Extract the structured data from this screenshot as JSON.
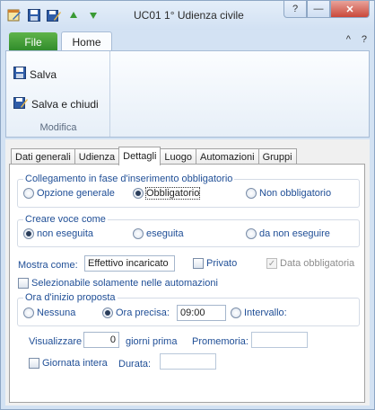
{
  "window": {
    "title": "UC01 1° Udienza civile",
    "help_glyph": "?",
    "minimize_glyph": "—",
    "close_glyph": "✕"
  },
  "ribbon": {
    "file_tab": "File",
    "home_tab": "Home",
    "collapse_glyph": "^",
    "help_glyph": "?",
    "group_label": "Modifica",
    "save_label": "Salva",
    "save_close_label": "Salva e chiudi"
  },
  "tabs": [
    "Dati generali",
    "Udienza",
    "Dettagli",
    "Luogo",
    "Automazioni",
    "Gruppi"
  ],
  "active_tab": "Dettagli",
  "collegamento": {
    "legend": "Collegamento in fase d'inserimento obbligatorio",
    "options": [
      "Opzione generale",
      "Obbligatorio",
      "Non obbligatorio"
    ],
    "selected": "Obbligatorio"
  },
  "creare_voce": {
    "legend": "Creare voce come",
    "options": [
      "non eseguita",
      "eseguita",
      "da non eseguire"
    ],
    "selected": "non eseguita"
  },
  "mostra_come": {
    "label": "Mostra come:",
    "value": "Effettivo incaricato",
    "privato_label": "Privato",
    "privato_checked": false,
    "data_obbligatoria_label": "Data obbligatoria",
    "data_obbligatoria_checked": true
  },
  "selezionabile": {
    "label": "Selezionabile solamente nelle automazioni",
    "checked": false
  },
  "ora_inizio": {
    "legend": "Ora d'inizio proposta",
    "options": [
      "Nessuna",
      "Ora precisa:",
      "Intervallo:"
    ],
    "selected": "Ora precisa:",
    "time_value": "09:00"
  },
  "visualizzare": {
    "label": "Visualizzare",
    "days_value": "0",
    "days_suffix": "giorni prima",
    "promemoria_label": "Promemoria:",
    "promemoria_value": ""
  },
  "giornata": {
    "label": "Giornata intera",
    "checked": false,
    "durata_label": "Durata:",
    "durata_value": ""
  },
  "colors": {
    "accent_blue": "#1f4e96",
    "file_tab_green": "#3c9a32",
    "close_red": "#c9483a"
  },
  "icons": {
    "app": "calendar-edit-icon",
    "save": "floppy-disk-icon",
    "save_close": "floppy-disk-pen-icon",
    "qat_up": "green-up-arrow-icon",
    "qat_down": "green-down-arrow-icon"
  }
}
